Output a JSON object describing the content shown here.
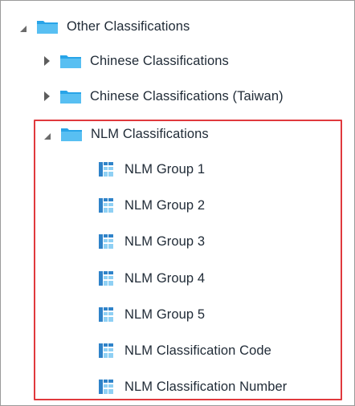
{
  "tree": {
    "root": {
      "label": "Other Classifications",
      "expanded": true
    },
    "children": [
      {
        "label": "Chinese Classifications",
        "expanded": false
      },
      {
        "label": "Chinese Classifications (Taiwan)",
        "expanded": false
      },
      {
        "label": "NLM Classifications",
        "expanded": true,
        "children": [
          {
            "label": "NLM Group 1"
          },
          {
            "label": "NLM Group 2"
          },
          {
            "label": "NLM Group 3"
          },
          {
            "label": "NLM Group 4"
          },
          {
            "label": "NLM Group 5"
          },
          {
            "label": "NLM Classification Code"
          },
          {
            "label": "NLM Classification Number"
          }
        ]
      }
    ]
  },
  "colors": {
    "folder": "#28A4E8",
    "table_icon": "#2F83C9",
    "highlight": "#E0393D",
    "text": "#1F2A36"
  }
}
